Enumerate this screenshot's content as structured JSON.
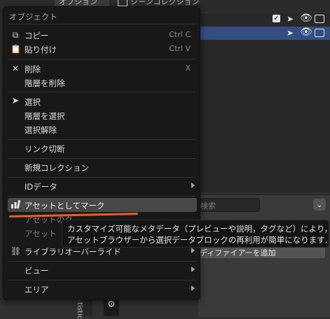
{
  "background": {
    "options_label": "オプション",
    "collection_label": "シーンコレクション",
    "search_placeholder": "検索",
    "add_modifier_label": "ディファイアーを追加",
    "side_tab_label": "tistic"
  },
  "menu": {
    "title": "オブジェクト",
    "items": {
      "copy": {
        "label": "コピー",
        "shortcut": "Ctrl C",
        "icon": "copy-icon"
      },
      "paste": {
        "label": "貼り付け",
        "shortcut": "Ctrl V",
        "icon": "paste-icon"
      },
      "delete": {
        "label": "削除",
        "shortcut": "X",
        "icon": "x-icon"
      },
      "delete_hierarchy": {
        "label": "階層を削除"
      },
      "select": {
        "label": "選択",
        "icon": "cursor-arrow-icon"
      },
      "select_hierarchy": {
        "label": "階層を選択"
      },
      "deselect": {
        "label": "選択解除"
      },
      "unlink": {
        "label": "リンク切断"
      },
      "new_collection": {
        "label": "新規コレクション"
      },
      "id_data": {
        "label": "IDデータ"
      },
      "mark_as_asset": {
        "label": "アセットとしてマーク",
        "icon": "asset-bars-icon"
      },
      "clear_asset": {
        "label": "アセットのク"
      },
      "clear_asset2": {
        "label": "アセット"
      },
      "library_override": {
        "label": "ライブラリオーバーライド",
        "icon": "link-icon"
      },
      "view": {
        "label": "ビュー"
      },
      "area": {
        "label": "エリア"
      }
    }
  },
  "tooltip": {
    "line1": "カスタマイズ可能なメタデータ（プレビューや説明，タグなど）により，",
    "line2": "アセットブラウザーから選択データブロックの再利用が簡単になります."
  },
  "colors": {
    "menu_bg": "#181818",
    "highlight_bg": "#484848",
    "annotation_underline": "#e8611f",
    "outliner_selected_row": "#334d80"
  }
}
